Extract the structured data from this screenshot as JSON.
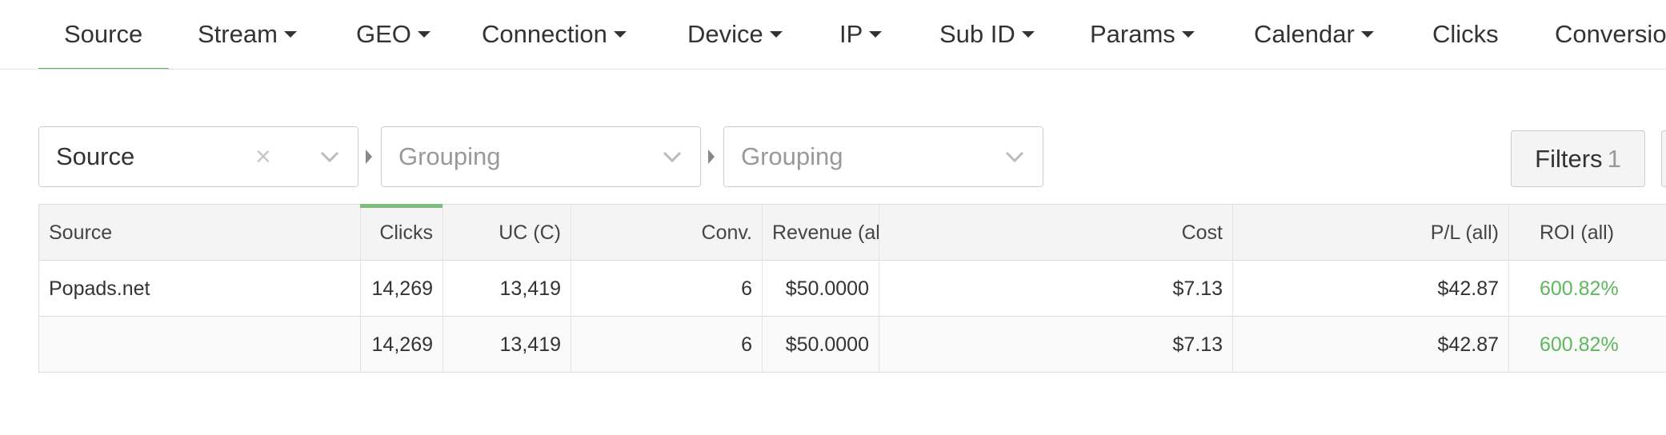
{
  "tabs": [
    {
      "label": "Source",
      "dropdown": false,
      "active": true
    },
    {
      "label": "Stream",
      "dropdown": true
    },
    {
      "label": "GEO",
      "dropdown": true
    },
    {
      "label": "Connection",
      "dropdown": true
    },
    {
      "label": "Device",
      "dropdown": true
    },
    {
      "label": "IP",
      "dropdown": true
    },
    {
      "label": "Sub ID",
      "dropdown": true
    },
    {
      "label": "Params",
      "dropdown": true
    },
    {
      "label": "Calendar",
      "dropdown": true
    },
    {
      "label": "Clicks",
      "dropdown": false
    },
    {
      "label": "Conversio",
      "dropdown": false
    }
  ],
  "grouping": {
    "first": {
      "value": "Source",
      "clear": "×"
    },
    "second": {
      "placeholder": "Grouping"
    },
    "third": {
      "placeholder": "Grouping"
    }
  },
  "filters": {
    "label": "Filters",
    "count": "1"
  },
  "table": {
    "headers": [
      "Source",
      "Clicks",
      "UC (C)",
      "Conv.",
      "Revenue (al",
      "Cost",
      "P/L (all)",
      "ROI (all)"
    ],
    "rows": [
      [
        "Popads.net",
        "14,269",
        "13,419",
        "6",
        "$50.0000",
        "$7.13",
        "$42.87",
        "600.82%"
      ]
    ],
    "totals": [
      "",
      "14,269",
      "13,419",
      "6",
      "$50.0000",
      "$7.13",
      "$42.87",
      "600.82%"
    ]
  },
  "colors": {
    "accent": "#5cb85c",
    "positive": "#5cb85c"
  }
}
